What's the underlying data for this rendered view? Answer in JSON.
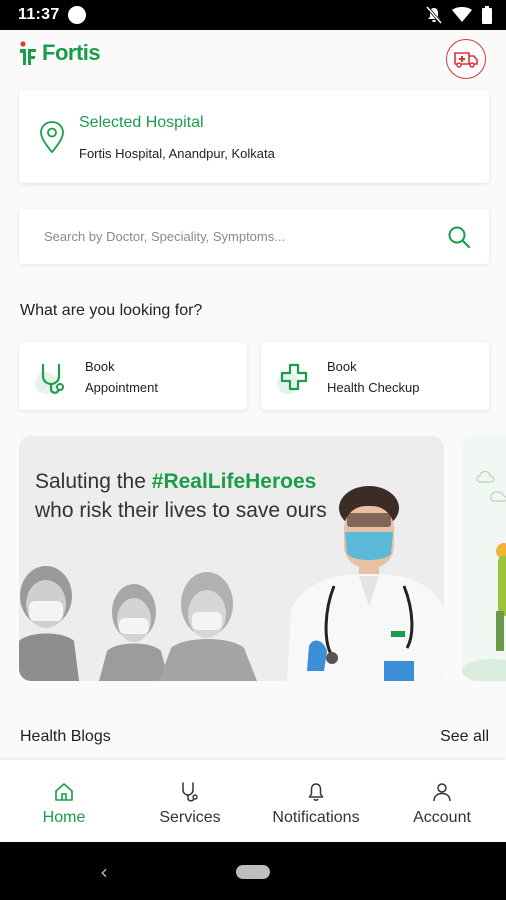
{
  "status_bar": {
    "time": "11:37"
  },
  "header": {
    "logo_text": "Fortis",
    "ambulance_icon": "ambulance-icon"
  },
  "hospital": {
    "label": "Selected Hospital",
    "name": "Fortis Hospital, Anandpur, Kolkata"
  },
  "search": {
    "placeholder": "Search by Doctor, Speciality, Symptoms..."
  },
  "section": {
    "title": "What are you looking for?"
  },
  "actions": [
    {
      "line1": "Book",
      "line2": "Appointment",
      "icon": "stethoscope-icon"
    },
    {
      "line1": "Book",
      "line2": "Health Checkup",
      "icon": "medical-cross-icon"
    }
  ],
  "banner": {
    "prefix": "Saluting the ",
    "highlight": "#RealLifeHeroes",
    "line2": "who risk their lives to save ours"
  },
  "blogs": {
    "title": "Health Blogs",
    "see_all": "See all"
  },
  "nav": {
    "items": [
      {
        "label": "Home",
        "icon": "home-icon",
        "active": true
      },
      {
        "label": "Services",
        "icon": "stethoscope-icon",
        "active": false
      },
      {
        "label": "Notifications",
        "icon": "bell-icon",
        "active": false
      },
      {
        "label": "Account",
        "icon": "person-icon",
        "active": false
      }
    ]
  },
  "colors": {
    "brand": "#1a9d4b",
    "ambulance": "#d33333"
  }
}
